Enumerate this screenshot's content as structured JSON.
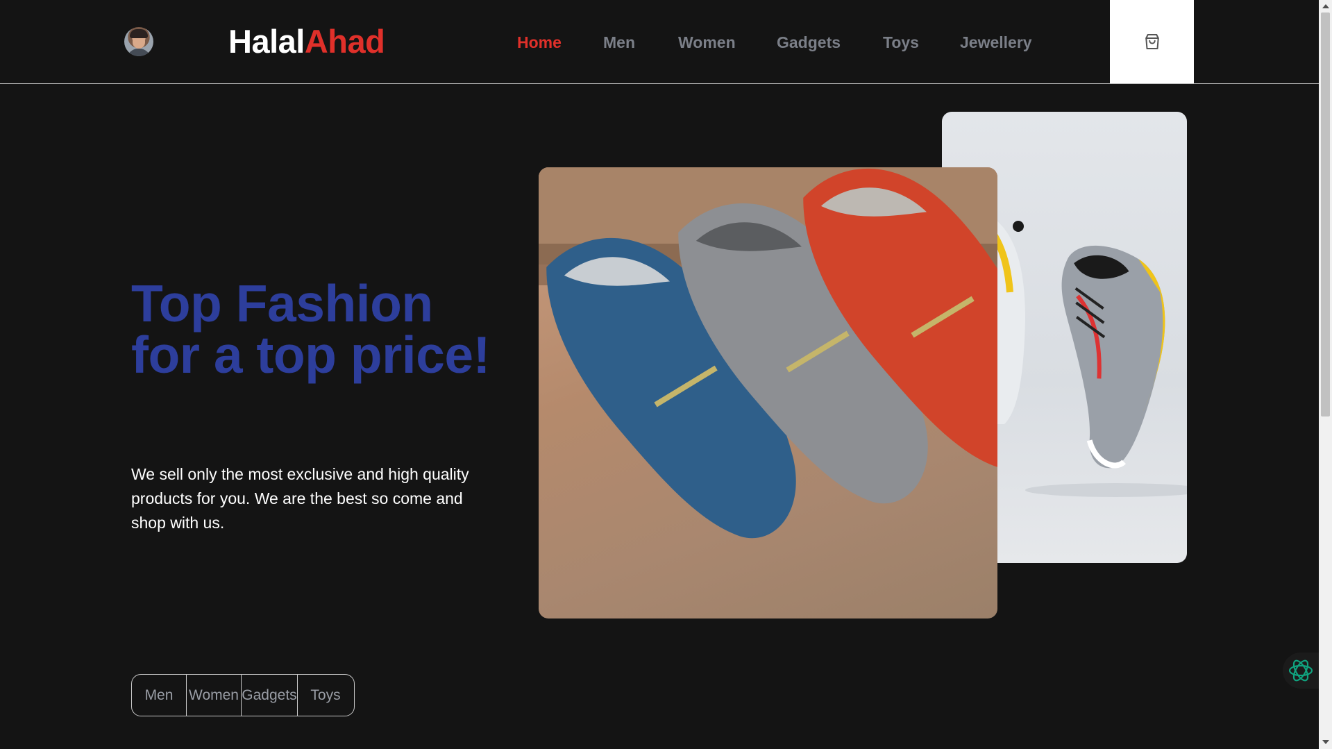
{
  "header": {
    "logo_part1": "Halal",
    "logo_part2": "Ahad",
    "nav": [
      {
        "label": "Home",
        "active": true
      },
      {
        "label": "Men",
        "active": false
      },
      {
        "label": "Women",
        "active": false
      },
      {
        "label": "Gadgets",
        "active": false
      },
      {
        "label": "Toys",
        "active": false
      },
      {
        "label": "Jewellery",
        "active": false
      }
    ],
    "cart_icon": "shopping-bag-icon"
  },
  "hero": {
    "title": "Top Fashion for a top price!",
    "text": "We sell only the most exclusive and high quality products for you. We are the best so come and shop with us.",
    "images": [
      "loafers-photo",
      "sneakers-photo"
    ]
  },
  "categories": [
    "Men",
    "Women",
    "Gadgets",
    "Toys"
  ],
  "colors": {
    "background": "#141414",
    "accent_red": "#e0302a",
    "title_blue": "#2d3e9c",
    "nav_gray": "#7b7f88"
  },
  "assistant_icon": "ai-assistant-icon"
}
